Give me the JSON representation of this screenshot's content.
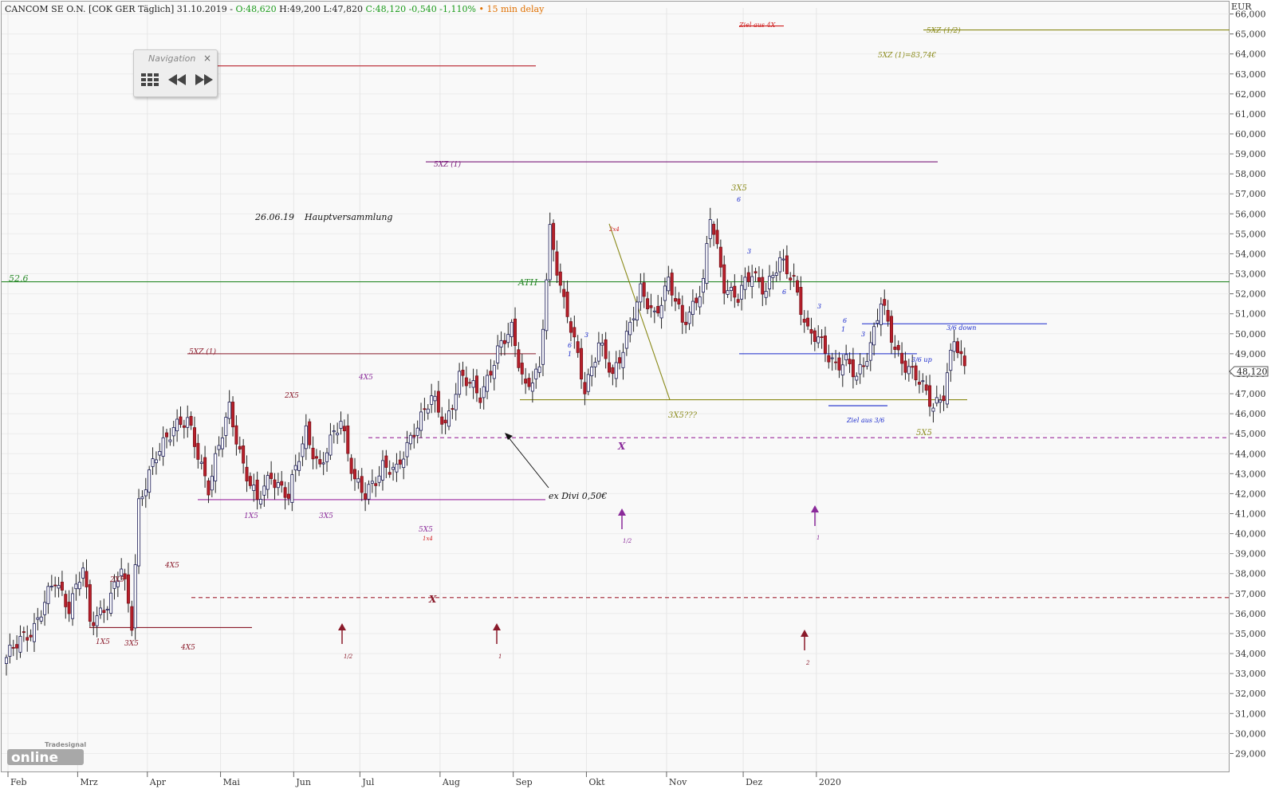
{
  "header": {
    "name": "CANCOM SE O.N. [COK GER Täglich] 31.10.2019 -",
    "open": "O:48,620",
    "hl": "H:49,200 L:47,820",
    "close": "C:48,120 -0,540 -1,110%",
    "bullet": "•",
    "delay": "15 min delay"
  },
  "navigation": {
    "title": "Navigation",
    "close": "×"
  },
  "logo": {
    "brand": "Tradesignal®",
    "word": "online"
  },
  "colors": {
    "up": "#ffffff",
    "down": "#b8202b",
    "wick": "#222222",
    "upBorder": "#1a1a55"
  },
  "chart_data": {
    "type": "candlestick",
    "currency": "EUR",
    "ylim": [
      28.5,
      66.3
    ],
    "y_ticks": [
      29,
      30,
      31,
      32,
      33,
      34,
      35,
      36,
      37,
      38,
      39,
      40,
      41,
      42,
      43,
      44,
      45,
      46,
      47,
      48,
      49,
      50,
      51,
      52,
      53,
      54,
      55,
      56,
      57,
      58,
      59,
      60,
      61,
      62,
      63,
      64,
      65,
      66
    ],
    "last_price": "48,120",
    "months": [
      "Feb",
      "Mrz",
      "Apr",
      "Mai",
      "Jun",
      "Jul",
      "Aug",
      "Sep",
      "Okt",
      "Nov",
      "Dez",
      "2020"
    ],
    "anchors": [
      [
        0,
        33.8
      ],
      [
        8,
        35.4
      ],
      [
        14,
        37.6
      ],
      [
        18,
        36.4
      ],
      [
        22,
        38.2
      ],
      [
        24,
        35.5
      ],
      [
        30,
        36.8
      ],
      [
        33,
        38.2
      ],
      [
        36,
        35.6
      ],
      [
        38,
        41.6
      ],
      [
        44,
        44.2
      ],
      [
        48,
        45.5
      ],
      [
        52,
        45.5
      ],
      [
        58,
        42.4
      ],
      [
        64,
        46.2
      ],
      [
        68,
        43.5
      ],
      [
        72,
        41.5
      ],
      [
        76,
        43.0
      ],
      [
        81,
        41.8
      ],
      [
        86,
        45.2
      ],
      [
        90,
        43.2
      ],
      [
        96,
        45.8
      ],
      [
        100,
        42.6
      ],
      [
        103,
        41.8
      ],
      [
        108,
        43.5
      ],
      [
        112,
        43.0
      ],
      [
        117,
        45.3
      ],
      [
        122,
        46.7
      ],
      [
        126,
        45.5
      ],
      [
        130,
        47.8
      ],
      [
        136,
        47.0
      ],
      [
        141,
        49.0
      ],
      [
        145,
        50.3
      ],
      [
        149,
        47.3
      ],
      [
        153,
        48.0
      ],
      [
        156,
        55.3
      ],
      [
        160,
        51.5
      ],
      [
        163,
        49.5
      ],
      [
        166,
        47.3
      ],
      [
        170,
        49.5
      ],
      [
        174,
        47.8
      ],
      [
        178,
        50.0
      ],
      [
        182,
        52.0
      ],
      [
        186,
        51.0
      ],
      [
        190,
        52.6
      ],
      [
        194,
        50.5
      ],
      [
        197,
        51.5
      ],
      [
        200,
        52.5
      ],
      [
        202,
        55.8
      ],
      [
        206,
        52.5
      ],
      [
        210,
        51.8
      ],
      [
        214,
        53.0
      ],
      [
        218,
        52.3
      ],
      [
        222,
        53.5
      ],
      [
        226,
        52.8
      ],
      [
        230,
        50.0
      ],
      [
        234,
        49.5
      ],
      [
        238,
        48.5
      ],
      [
        241,
        48.5
      ],
      [
        244,
        47.8
      ],
      [
        248,
        49.5
      ],
      [
        251,
        51.5
      ],
      [
        255,
        49.3
      ],
      [
        258,
        48.5
      ],
      [
        262,
        47.5
      ],
      [
        266,
        46.5
      ],
      [
        269,
        47.0
      ],
      [
        272,
        49.6
      ],
      [
        275,
        48.3
      ]
    ],
    "lines": [
      {
        "label": "ATH",
        "value": 52.6
      },
      {
        "label": "52,6",
        "value": 52.6
      },
      {
        "label": "5XZ (1)",
        "value": 58.6
      },
      {
        "label": "5XZ (1)",
        "value": 49.0
      },
      {
        "label": "5XZ (1/2)",
        "value": 65.2
      },
      {
        "label": "5XZ (1)=83,74€",
        "value": 64.3
      },
      {
        "label": "Ziel aus 4X",
        "value": 65.6
      },
      {
        "label": "3/6 down",
        "value": 50.5
      },
      {
        "label": "3/6 up",
        "value": 49.0
      },
      {
        "label": "Ziel aus 3/6",
        "value": 46.4
      }
    ],
    "annotations": [
      "26.06.19",
      "Hauptversammlung",
      "ex Divi 0,50€",
      "3X5",
      "3X5???",
      "5X5",
      "2x4",
      "4X5",
      "2X5",
      "1X5",
      "3X5",
      "5X5",
      "1x4",
      "X",
      "X",
      "1/2",
      "1",
      "2",
      "6",
      "3"
    ]
  }
}
